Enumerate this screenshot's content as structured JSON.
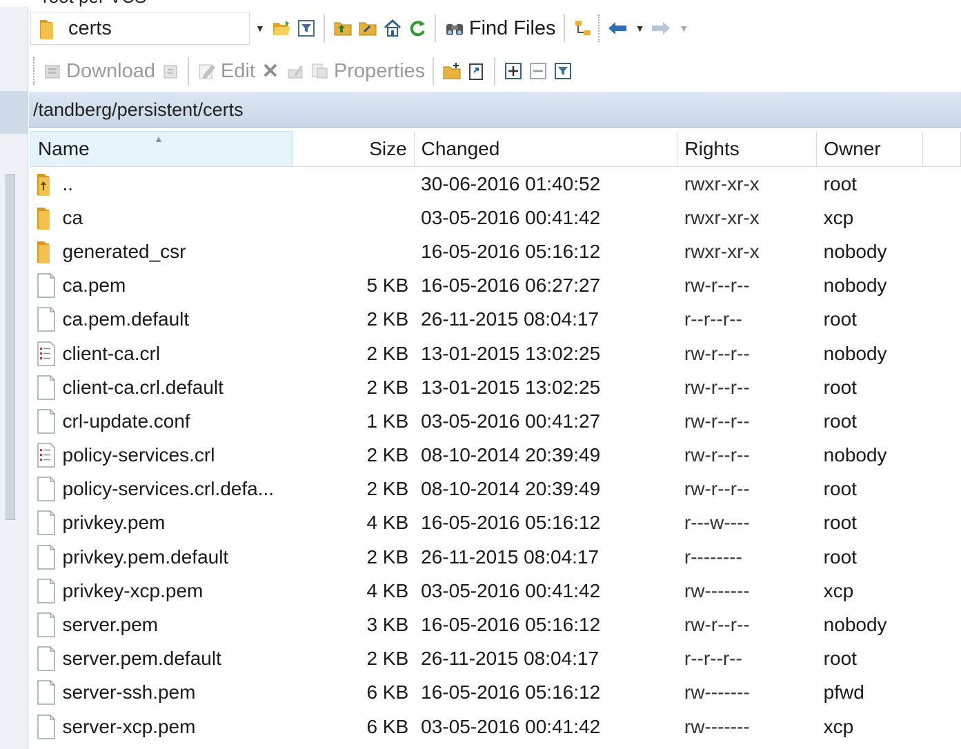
{
  "caption": "root per VCS",
  "toolbar1": {
    "folder_combo": "certs",
    "find_files": "Find Files"
  },
  "toolbar2": {
    "download": "Download",
    "edit": "Edit",
    "properties": "Properties"
  },
  "path": "/tandberg/persistent/certs",
  "columns": {
    "name": "Name",
    "size": "Size",
    "changed": "Changed",
    "rights": "Rights",
    "owner": "Owner"
  },
  "files": [
    {
      "icon": "parent-folder-icon",
      "name": "..",
      "size": "",
      "changed": "30-06-2016 01:40:52",
      "rights": "rwxr-xr-x",
      "owner": "root"
    },
    {
      "icon": "folder-icon",
      "name": "ca",
      "size": "",
      "changed": "03-05-2016 00:41:42",
      "rights": "rwxr-xr-x",
      "owner": "xcp"
    },
    {
      "icon": "folder-icon",
      "name": "generated_csr",
      "size": "",
      "changed": "16-05-2016 05:16:12",
      "rights": "rwxr-xr-x",
      "owner": "nobody"
    },
    {
      "icon": "file-icon",
      "name": "ca.pem",
      "size": "5 KB",
      "changed": "16-05-2016 06:27:27",
      "rights": "rw-r--r--",
      "owner": "nobody"
    },
    {
      "icon": "file-icon",
      "name": "ca.pem.default",
      "size": "2 KB",
      "changed": "26-11-2015 08:04:17",
      "rights": "r--r--r--",
      "owner": "root"
    },
    {
      "icon": "crl-file-icon",
      "name": "client-ca.crl",
      "size": "2 KB",
      "changed": "13-01-2015 13:02:25",
      "rights": "rw-r--r--",
      "owner": "nobody"
    },
    {
      "icon": "file-icon",
      "name": "client-ca.crl.default",
      "size": "2 KB",
      "changed": "13-01-2015 13:02:25",
      "rights": "rw-r--r--",
      "owner": "root"
    },
    {
      "icon": "file-icon",
      "name": "crl-update.conf",
      "size": "1 KB",
      "changed": "03-05-2016 00:41:27",
      "rights": "rw-r--r--",
      "owner": "root"
    },
    {
      "icon": "crl-file-icon",
      "name": "policy-services.crl",
      "size": "2 KB",
      "changed": "08-10-2014 20:39:49",
      "rights": "rw-r--r--",
      "owner": "nobody"
    },
    {
      "icon": "file-icon",
      "name": "policy-services.crl.defa...",
      "size": "2 KB",
      "changed": "08-10-2014 20:39:49",
      "rights": "rw-r--r--",
      "owner": "root"
    },
    {
      "icon": "file-icon",
      "name": "privkey.pem",
      "size": "4 KB",
      "changed": "16-05-2016 05:16:12",
      "rights": "r---w----",
      "owner": "root"
    },
    {
      "icon": "file-icon",
      "name": "privkey.pem.default",
      "size": "2 KB",
      "changed": "26-11-2015 08:04:17",
      "rights": "r--------",
      "owner": "root"
    },
    {
      "icon": "file-icon",
      "name": "privkey-xcp.pem",
      "size": "4 KB",
      "changed": "03-05-2016 00:41:42",
      "rights": "rw-------",
      "owner": "xcp"
    },
    {
      "icon": "file-icon",
      "name": "server.pem",
      "size": "3 KB",
      "changed": "16-05-2016 05:16:12",
      "rights": "rw-r--r--",
      "owner": "nobody"
    },
    {
      "icon": "file-icon",
      "name": "server.pem.default",
      "size": "2 KB",
      "changed": "26-11-2015 08:04:17",
      "rights": "r--r--r--",
      "owner": "root"
    },
    {
      "icon": "file-icon",
      "name": "server-ssh.pem",
      "size": "6 KB",
      "changed": "16-05-2016 05:16:12",
      "rights": "rw-------",
      "owner": "pfwd"
    },
    {
      "icon": "file-icon",
      "name": "server-xcp.pem",
      "size": "6 KB",
      "changed": "03-05-2016 00:41:42",
      "rights": "rw-------",
      "owner": "xcp"
    }
  ],
  "colors": {
    "folder": "#e8b030",
    "header_selected": "#e5f3fb",
    "pathbar": "#cfdcea"
  }
}
